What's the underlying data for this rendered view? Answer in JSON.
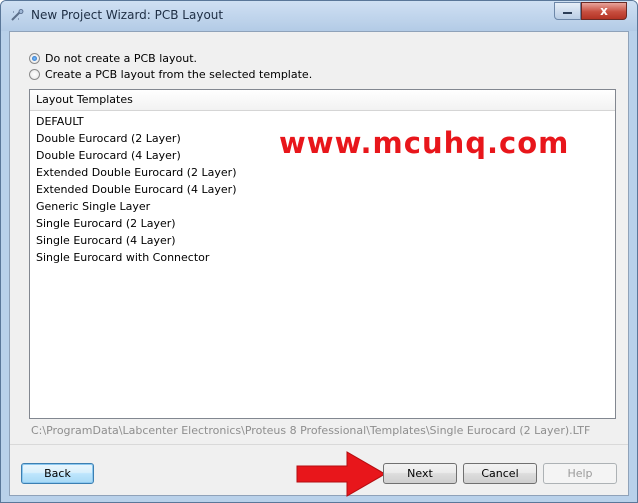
{
  "window": {
    "title": "New Project Wizard: PCB Layout",
    "close_glyph": "x"
  },
  "options": [
    {
      "label": "Do not create a PCB layout.",
      "checked": true
    },
    {
      "label": "Create a PCB layout from the selected template.",
      "checked": false
    }
  ],
  "templates": {
    "header": "Layout Templates",
    "items": [
      "DEFAULT",
      "Double Eurocard (2 Layer)",
      "Double Eurocard (4 Layer)",
      "Extended Double Eurocard (2 Layer)",
      "Extended Double Eurocard (4 Layer)",
      "Generic Single Layer",
      "Single Eurocard (2 Layer)",
      "Single Eurocard (4 Layer)",
      "Single Eurocard with Connector"
    ]
  },
  "watermark": "www.mcuhq.com",
  "template_path": "C:\\ProgramData\\Labcenter Electronics\\Proteus 8 Professional\\Templates\\Single Eurocard (2 Layer).LTF",
  "buttons": {
    "back": "Back",
    "next": "Next",
    "cancel": "Cancel",
    "help": "Help"
  },
  "colors": {
    "watermark": "#e8161b",
    "arrow": "#e8161b"
  }
}
